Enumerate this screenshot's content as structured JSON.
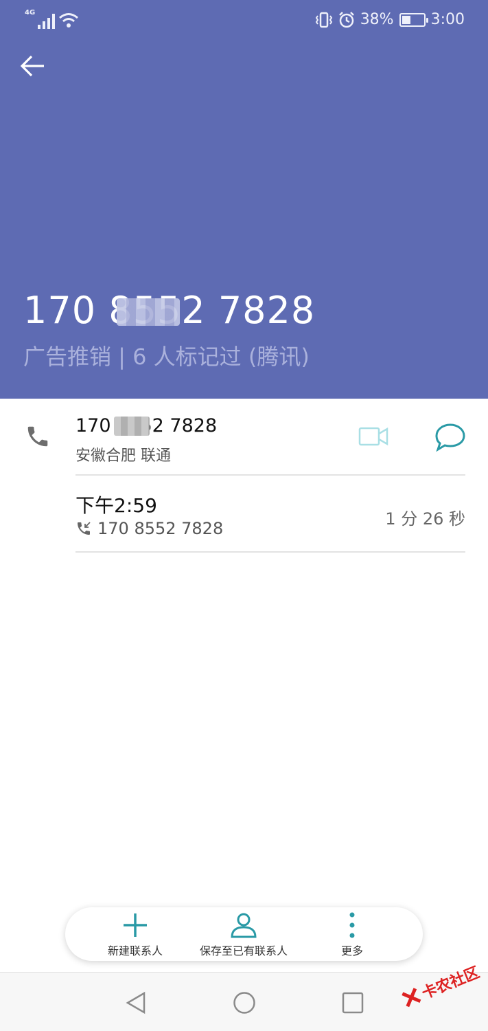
{
  "status_bar": {
    "network": "4G",
    "battery": "38%",
    "time": "3:00"
  },
  "caller": {
    "number": "170 8552 7828",
    "tag": "广告推销 | 6 人标记过 (腾讯)"
  },
  "detail_row": {
    "number": "170 8552 7828",
    "location": "安徽合肥 联通"
  },
  "call_log": {
    "time": "下午2:59",
    "number": "170 8552 7828",
    "duration": "1 分 26 秒"
  },
  "actions": {
    "new_contact": "新建联系人",
    "save_existing": "保存至已有联系人",
    "more": "更多"
  },
  "watermark": "卡农社区",
  "colors": {
    "header": "#5e6bb3",
    "accent": "#2a9aa6"
  }
}
